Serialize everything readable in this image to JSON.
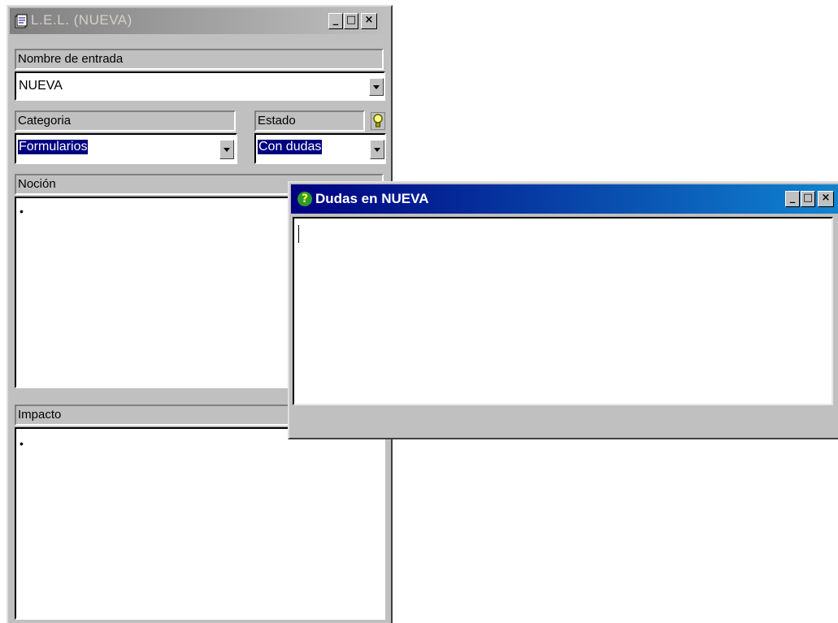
{
  "lel_window": {
    "title": "L.E.L. (NUEVA)",
    "minimize": "_",
    "maximize": "□",
    "close": "×",
    "entry_name_label": "Nombre de entrada",
    "entry_name_value": "NUEVA",
    "category_label": "Categoria",
    "category_value": "Formularios",
    "state_label": "Estado",
    "state_value": "Con dudas",
    "notion_label": "Noción",
    "notion_bullet": "•",
    "impact_label": "Impacto",
    "impact_bullet": "•"
  },
  "doubts_window": {
    "title": "Dudas en NUEVA",
    "question_icon": "?",
    "minimize": "_",
    "maximize": "□",
    "close": "×",
    "text": ""
  },
  "colors": {
    "active_title_start": "#000080",
    "active_title_end": "#1084d0",
    "inactive_title_start": "#808080",
    "inactive_title_end": "#c0c0c0",
    "selection": "#000080"
  },
  "icons": {
    "app_icon": "document-app-icon",
    "hint_icon": "lightbulb-icon",
    "question_icon": "question-mark-icon"
  }
}
